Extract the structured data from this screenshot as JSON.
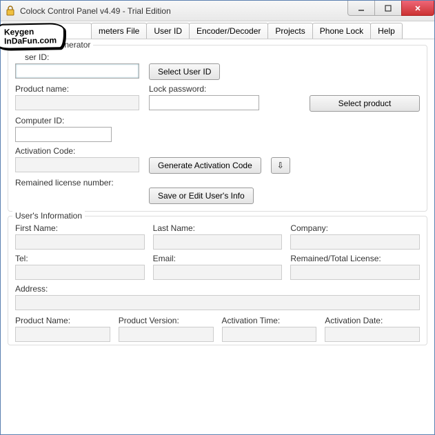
{
  "window": {
    "title": "Colock Control Panel v4.49 - Trial Edition"
  },
  "watermark": {
    "line1": "Keygen",
    "line2": "InDaFun.com"
  },
  "tabs": [
    {
      "label": "C"
    },
    {
      "label": "meters File"
    },
    {
      "label": "User ID"
    },
    {
      "label": "Encoder/Decoder"
    },
    {
      "label": "Projects"
    },
    {
      "label": "Phone Lock"
    },
    {
      "label": "Help"
    }
  ],
  "generator": {
    "group_title_partial": "enerator",
    "user_id_label_partial": "ser ID:",
    "select_user_id_btn": "Select User ID",
    "product_name_label": "Product name:",
    "lock_password_label": "Lock password:",
    "select_product_btn": "Select product",
    "computer_id_label": "Computer ID:",
    "activation_code_label": "Activation Code:",
    "generate_btn": "Generate Activation Code",
    "remained_label": "Remained license number:",
    "save_btn": "Save or Edit User's Info"
  },
  "userinfo": {
    "group_title": "User's Information",
    "first_name": "First Name:",
    "last_name": "Last Name:",
    "company": "Company:",
    "tel": "Tel:",
    "email": "Email:",
    "remained_total": "Remained/Total License:",
    "address": "Address:",
    "product_name": "Product Name:",
    "product_version": "Product Version:",
    "activation_time": "Activation Time:",
    "activation_date": "Activation Date:"
  }
}
